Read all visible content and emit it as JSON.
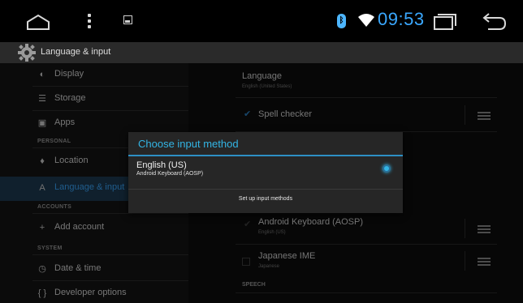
{
  "status_bar": {
    "time": "09:53",
    "icons": [
      "home-icon",
      "menu-icon",
      "picture-icon",
      "bluetooth-icon",
      "wifi-icon",
      "recents-icon",
      "back-icon"
    ],
    "clock_color": "#3aa8ff"
  },
  "action_bar": {
    "title": "Language & input",
    "icon": "settings-gear-icon"
  },
  "sidebar": {
    "items": [
      {
        "label": "Display",
        "icon": "display-icon"
      },
      {
        "label": "Storage",
        "icon": "storage-icon"
      },
      {
        "label": "Apps",
        "icon": "apps-icon"
      },
      {
        "label": "Location",
        "icon": "location-icon"
      },
      {
        "label": "Language & input",
        "icon": "language-icon",
        "active": true
      },
      {
        "label": "Add account",
        "icon": "add-icon"
      },
      {
        "label": "Date & time",
        "icon": "clock-icon"
      },
      {
        "label": "Developer options",
        "icon": "braces-icon"
      }
    ],
    "headers": {
      "personal": "PERSONAL",
      "accounts": "ACCOUNTS",
      "system": "SYSTEM"
    }
  },
  "panel": {
    "language_title": "Language",
    "language_value": "English (United States)",
    "spell_checker": "Spell checker",
    "keyboard1_title": "Android Keyboard (AOSP)",
    "keyboard1_sub": "English (US)",
    "keyboard2_title": "Japanese IME",
    "keyboard2_sub": "Japanese",
    "speech_header": "SPEECH"
  },
  "dialog": {
    "title": "Choose input method",
    "option_title": "English (US)",
    "option_sub": "Android Keyboard (AOSP)",
    "option_selected": true,
    "button": "Set up input methods",
    "accent": "#33b5e5"
  }
}
